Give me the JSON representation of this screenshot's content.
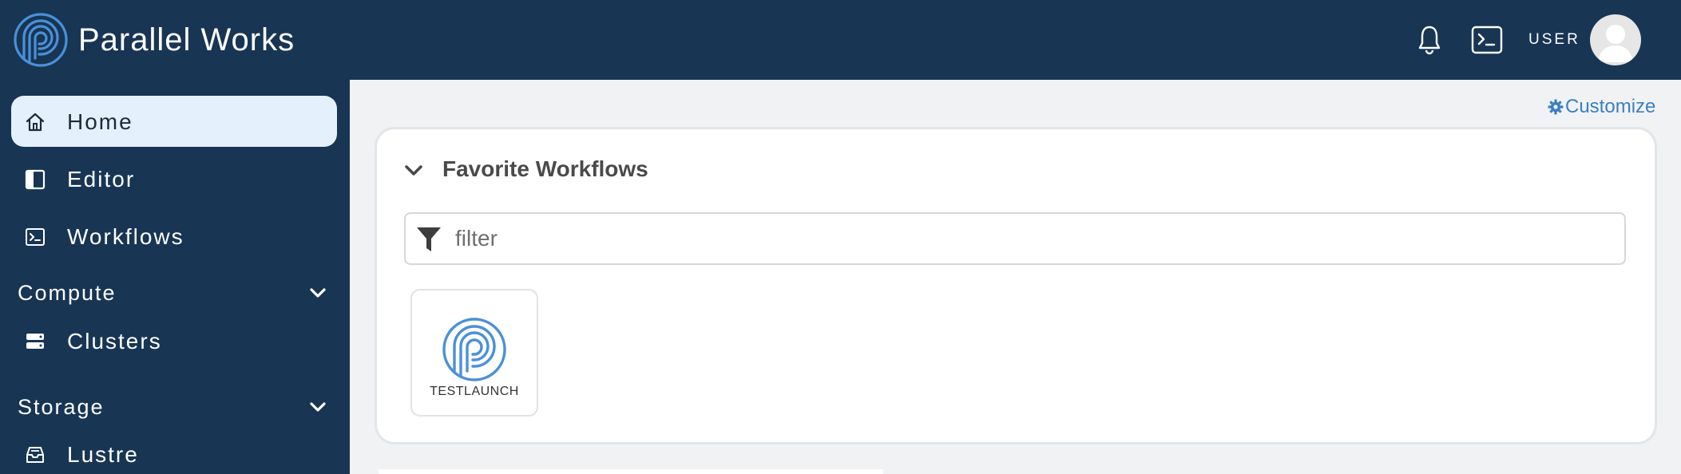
{
  "header": {
    "brand": "Parallel Works",
    "user_label": "USER"
  },
  "sidebar": {
    "items": [
      {
        "label": "Home",
        "icon": "home-icon",
        "active": true
      },
      {
        "label": "Editor",
        "icon": "editor-icon"
      },
      {
        "label": "Workflows",
        "icon": "terminal-icon"
      }
    ],
    "sections": [
      {
        "label": "Compute",
        "items": [
          {
            "label": "Clusters",
            "icon": "server-icon"
          }
        ]
      },
      {
        "label": "Storage",
        "items": [
          {
            "label": "Lustre",
            "icon": "inbox-icon"
          }
        ]
      }
    ]
  },
  "main": {
    "customize_label": "Customize",
    "favorites": {
      "title": "Favorite Workflows",
      "filter_placeholder": "filter",
      "filter_value": "",
      "workflows": [
        {
          "label": "TESTLAUNCH"
        }
      ]
    }
  },
  "colors": {
    "header_bg": "#183554",
    "sidebar_bg": "#183554",
    "active_item_bg": "#e4f0fb",
    "accent": "#3c7fc4",
    "page_bg": "#f0f2f4"
  }
}
